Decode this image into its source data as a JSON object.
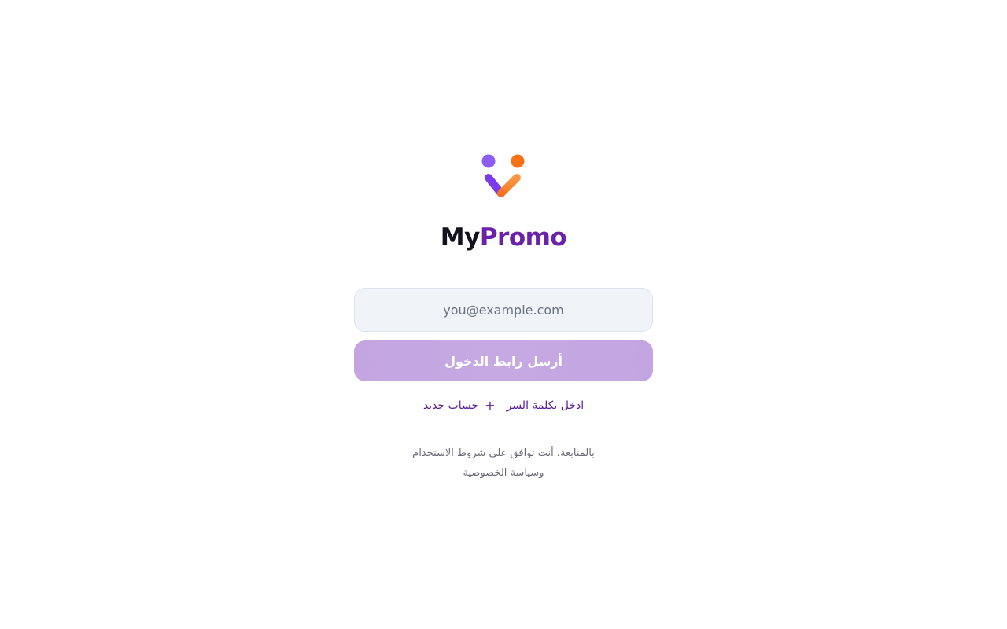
{
  "brand": {
    "name_part1": "My",
    "name_part2": "Promo",
    "logo_icon": "mypromo-logo-icon",
    "colors": {
      "dark": "#15121f",
      "purple": "#6b21a8",
      "orange": "#f97316"
    }
  },
  "form": {
    "email_placeholder": "you@example.com",
    "email_value": "",
    "submit_label": "أرسل رابط الدخول",
    "submit_color": "#c3a6e1"
  },
  "links": {
    "password_login": "ادخل بكلمة السر",
    "new_account": "حساب جديد",
    "new_account_icon": "plus-icon"
  },
  "terms": {
    "line1": "بالمتابعة، أنت توافق على شروط الاستخدام",
    "line2": "وسياسة الخصوصية"
  }
}
